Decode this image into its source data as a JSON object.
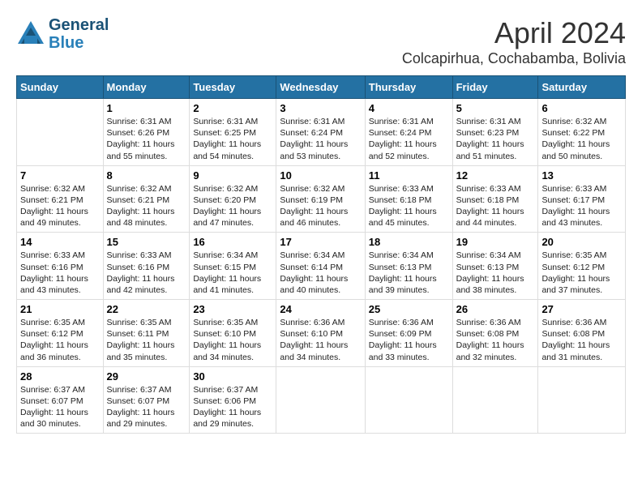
{
  "header": {
    "logo_line1": "General",
    "logo_line2": "Blue",
    "month": "April 2024",
    "location": "Colcapirhua, Cochabamba, Bolivia"
  },
  "days_of_week": [
    "Sunday",
    "Monday",
    "Tuesday",
    "Wednesday",
    "Thursday",
    "Friday",
    "Saturday"
  ],
  "weeks": [
    [
      {
        "day": "",
        "info": ""
      },
      {
        "day": "1",
        "info": "Sunrise: 6:31 AM\nSunset: 6:26 PM\nDaylight: 11 hours\nand 55 minutes."
      },
      {
        "day": "2",
        "info": "Sunrise: 6:31 AM\nSunset: 6:25 PM\nDaylight: 11 hours\nand 54 minutes."
      },
      {
        "day": "3",
        "info": "Sunrise: 6:31 AM\nSunset: 6:24 PM\nDaylight: 11 hours\nand 53 minutes."
      },
      {
        "day": "4",
        "info": "Sunrise: 6:31 AM\nSunset: 6:24 PM\nDaylight: 11 hours\nand 52 minutes."
      },
      {
        "day": "5",
        "info": "Sunrise: 6:31 AM\nSunset: 6:23 PM\nDaylight: 11 hours\nand 51 minutes."
      },
      {
        "day": "6",
        "info": "Sunrise: 6:32 AM\nSunset: 6:22 PM\nDaylight: 11 hours\nand 50 minutes."
      }
    ],
    [
      {
        "day": "7",
        "info": "Sunrise: 6:32 AM\nSunset: 6:21 PM\nDaylight: 11 hours\nand 49 minutes."
      },
      {
        "day": "8",
        "info": "Sunrise: 6:32 AM\nSunset: 6:21 PM\nDaylight: 11 hours\nand 48 minutes."
      },
      {
        "day": "9",
        "info": "Sunrise: 6:32 AM\nSunset: 6:20 PM\nDaylight: 11 hours\nand 47 minutes."
      },
      {
        "day": "10",
        "info": "Sunrise: 6:32 AM\nSunset: 6:19 PM\nDaylight: 11 hours\nand 46 minutes."
      },
      {
        "day": "11",
        "info": "Sunrise: 6:33 AM\nSunset: 6:18 PM\nDaylight: 11 hours\nand 45 minutes."
      },
      {
        "day": "12",
        "info": "Sunrise: 6:33 AM\nSunset: 6:18 PM\nDaylight: 11 hours\nand 44 minutes."
      },
      {
        "day": "13",
        "info": "Sunrise: 6:33 AM\nSunset: 6:17 PM\nDaylight: 11 hours\nand 43 minutes."
      }
    ],
    [
      {
        "day": "14",
        "info": "Sunrise: 6:33 AM\nSunset: 6:16 PM\nDaylight: 11 hours\nand 43 minutes."
      },
      {
        "day": "15",
        "info": "Sunrise: 6:33 AM\nSunset: 6:16 PM\nDaylight: 11 hours\nand 42 minutes."
      },
      {
        "day": "16",
        "info": "Sunrise: 6:34 AM\nSunset: 6:15 PM\nDaylight: 11 hours\nand 41 minutes."
      },
      {
        "day": "17",
        "info": "Sunrise: 6:34 AM\nSunset: 6:14 PM\nDaylight: 11 hours\nand 40 minutes."
      },
      {
        "day": "18",
        "info": "Sunrise: 6:34 AM\nSunset: 6:13 PM\nDaylight: 11 hours\nand 39 minutes."
      },
      {
        "day": "19",
        "info": "Sunrise: 6:34 AM\nSunset: 6:13 PM\nDaylight: 11 hours\nand 38 minutes."
      },
      {
        "day": "20",
        "info": "Sunrise: 6:35 AM\nSunset: 6:12 PM\nDaylight: 11 hours\nand 37 minutes."
      }
    ],
    [
      {
        "day": "21",
        "info": "Sunrise: 6:35 AM\nSunset: 6:12 PM\nDaylight: 11 hours\nand 36 minutes."
      },
      {
        "day": "22",
        "info": "Sunrise: 6:35 AM\nSunset: 6:11 PM\nDaylight: 11 hours\nand 35 minutes."
      },
      {
        "day": "23",
        "info": "Sunrise: 6:35 AM\nSunset: 6:10 PM\nDaylight: 11 hours\nand 34 minutes."
      },
      {
        "day": "24",
        "info": "Sunrise: 6:36 AM\nSunset: 6:10 PM\nDaylight: 11 hours\nand 34 minutes."
      },
      {
        "day": "25",
        "info": "Sunrise: 6:36 AM\nSunset: 6:09 PM\nDaylight: 11 hours\nand 33 minutes."
      },
      {
        "day": "26",
        "info": "Sunrise: 6:36 AM\nSunset: 6:08 PM\nDaylight: 11 hours\nand 32 minutes."
      },
      {
        "day": "27",
        "info": "Sunrise: 6:36 AM\nSunset: 6:08 PM\nDaylight: 11 hours\nand 31 minutes."
      }
    ],
    [
      {
        "day": "28",
        "info": "Sunrise: 6:37 AM\nSunset: 6:07 PM\nDaylight: 11 hours\nand 30 minutes."
      },
      {
        "day": "29",
        "info": "Sunrise: 6:37 AM\nSunset: 6:07 PM\nDaylight: 11 hours\nand 29 minutes."
      },
      {
        "day": "30",
        "info": "Sunrise: 6:37 AM\nSunset: 6:06 PM\nDaylight: 11 hours\nand 29 minutes."
      },
      {
        "day": "",
        "info": ""
      },
      {
        "day": "",
        "info": ""
      },
      {
        "day": "",
        "info": ""
      },
      {
        "day": "",
        "info": ""
      }
    ]
  ]
}
